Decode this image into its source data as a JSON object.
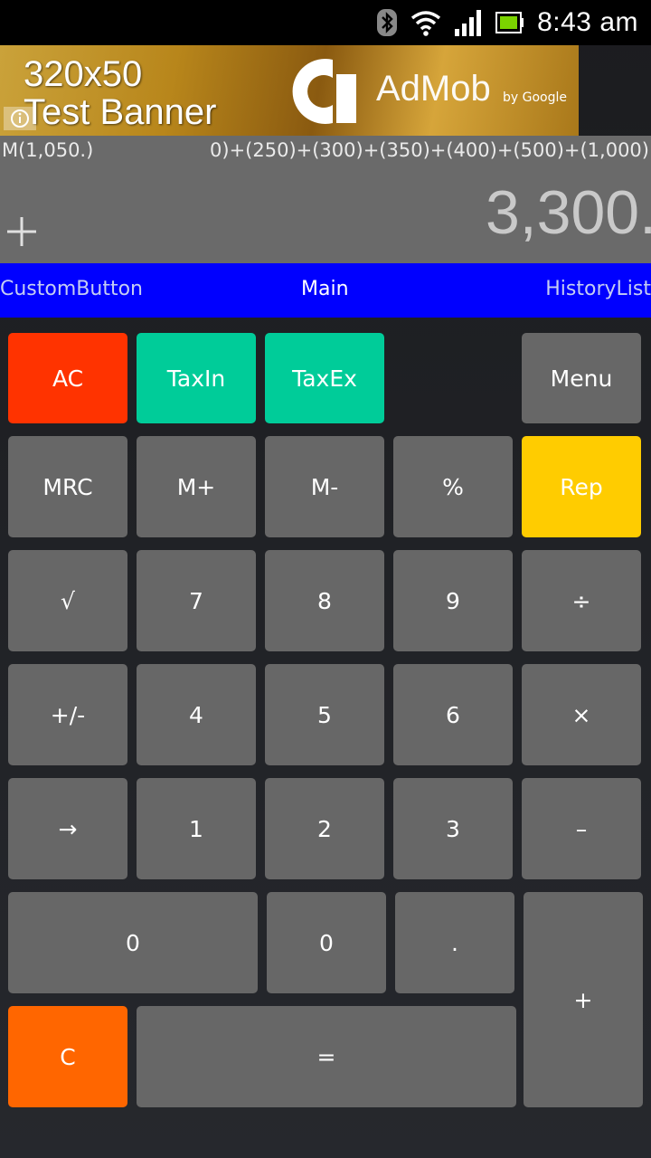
{
  "status_bar": {
    "time": "8:43 am",
    "icons": [
      "bluetooth-icon",
      "wifi-icon",
      "signal-icon",
      "battery-icon"
    ]
  },
  "ad": {
    "line1": "320x50",
    "line2": "Test Banner",
    "brand": "AdMob",
    "byline": "by Google"
  },
  "display": {
    "memory": "M(1,050.)",
    "history": "0)+(250)+(300)+(350)+(400)+(500)+(1,000)",
    "result": "3,300."
  },
  "tabs": {
    "left": "CustomButton",
    "center": "Main",
    "right": "HistoryList"
  },
  "keys": {
    "ac": "AC",
    "taxin": "TaxIn",
    "taxex": "TaxEx",
    "menu": "Menu",
    "mrc": "MRC",
    "mplus": "M+",
    "mminus": "M-",
    "percent": "%",
    "rep": "Rep",
    "sqrt": "√",
    "k7": "7",
    "k8": "8",
    "k9": "9",
    "divide": "÷",
    "sign": "+/-",
    "k4": "4",
    "k5": "5",
    "k6": "6",
    "multiply": "×",
    "arrow": "→",
    "k1": "1",
    "k2": "2",
    "k3": "3",
    "minus": "–",
    "k0wide": "0",
    "k0": "0",
    "dot": ".",
    "plus": "+",
    "clear": "C",
    "equals": "="
  },
  "colors": {
    "ac": "#ff3300",
    "tax": "#00cc99",
    "rep": "#ffcc00",
    "clear": "#ff6600",
    "tab_bar": "#0000ff",
    "key": "#676767"
  }
}
